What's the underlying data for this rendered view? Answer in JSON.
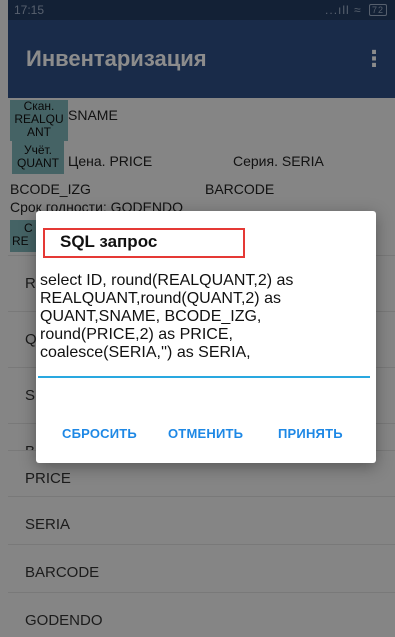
{
  "status_bar": {
    "time": "17:15",
    "signal": "...ıll",
    "wifi": "≈",
    "battery": "72"
  },
  "app_bar": {
    "title": "Инвентаризация",
    "menu_icon": "⋮"
  },
  "background": {
    "chip_scan_l1": "Скан.",
    "chip_scan_l2": "REALQU",
    "chip_scan_l3": "ANT",
    "sname": "SNAME",
    "chip_account_l1": "Учёт.",
    "chip_account_l2": "QUANT",
    "price": "Цена. PRICE",
    "seria": "Серия. SERIA",
    "bcode": "BCODE_IZG",
    "barcode": "BARCODE",
    "expiry": "Срок годности: GODENDO",
    "chip_c": "С",
    "chip_re": "RE"
  },
  "list_items": [
    {
      "label": "R"
    },
    {
      "label": "Q"
    },
    {
      "label": "S"
    },
    {
      "label": "B"
    },
    {
      "label": "PRICE"
    },
    {
      "label": "SERIA"
    },
    {
      "label": "BARCODE"
    },
    {
      "label": "GODENDO"
    }
  ],
  "dialog": {
    "title": "SQL запрос",
    "query": "select ID, round(REALQUANT,2) as REALQUANT,round(QUANT,2) as QUANT,SNAME, BCODE_IZG, round(PRICE,2) as PRICE, coalesce(SERIA,'') as SERIA,",
    "reset_label": "СБРОСИТЬ",
    "cancel_label": "ОТМЕНИТЬ",
    "accept_label": "ПРИНЯТЬ"
  },
  "colors": {
    "app_bar": "#2f4f86",
    "status_bar": "#243d63",
    "chip": "#7fb4b8",
    "accent": "#1e88e5",
    "highlight": "#e53935"
  }
}
